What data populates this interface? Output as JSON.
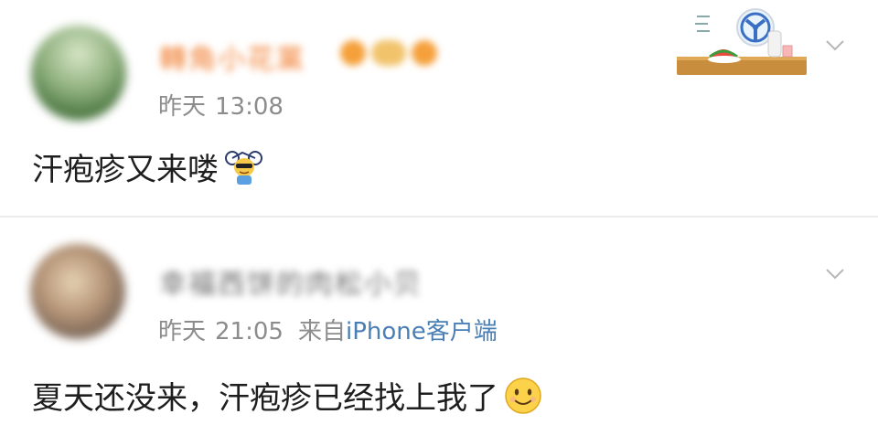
{
  "post1": {
    "username": "轉角小花黨",
    "time_day": "昨天",
    "time_clock": "13:08",
    "content": "汗疱疹又来喽",
    "emoji": "cool-cat-bicycle-emoji"
  },
  "post2": {
    "username": "幸福西饼的肉松小贝",
    "time_day": "昨天",
    "time_clock": "21:05",
    "from_label": "来自",
    "device": "iPhone客户端",
    "content": "夏天还没来，汗疱疹已经找上我了",
    "emoji": "smile-emoji"
  },
  "colors": {
    "meta_gray": "#8c8c8c",
    "device_blue": "#4a7fb5",
    "username_orange": "#f07b2c"
  }
}
